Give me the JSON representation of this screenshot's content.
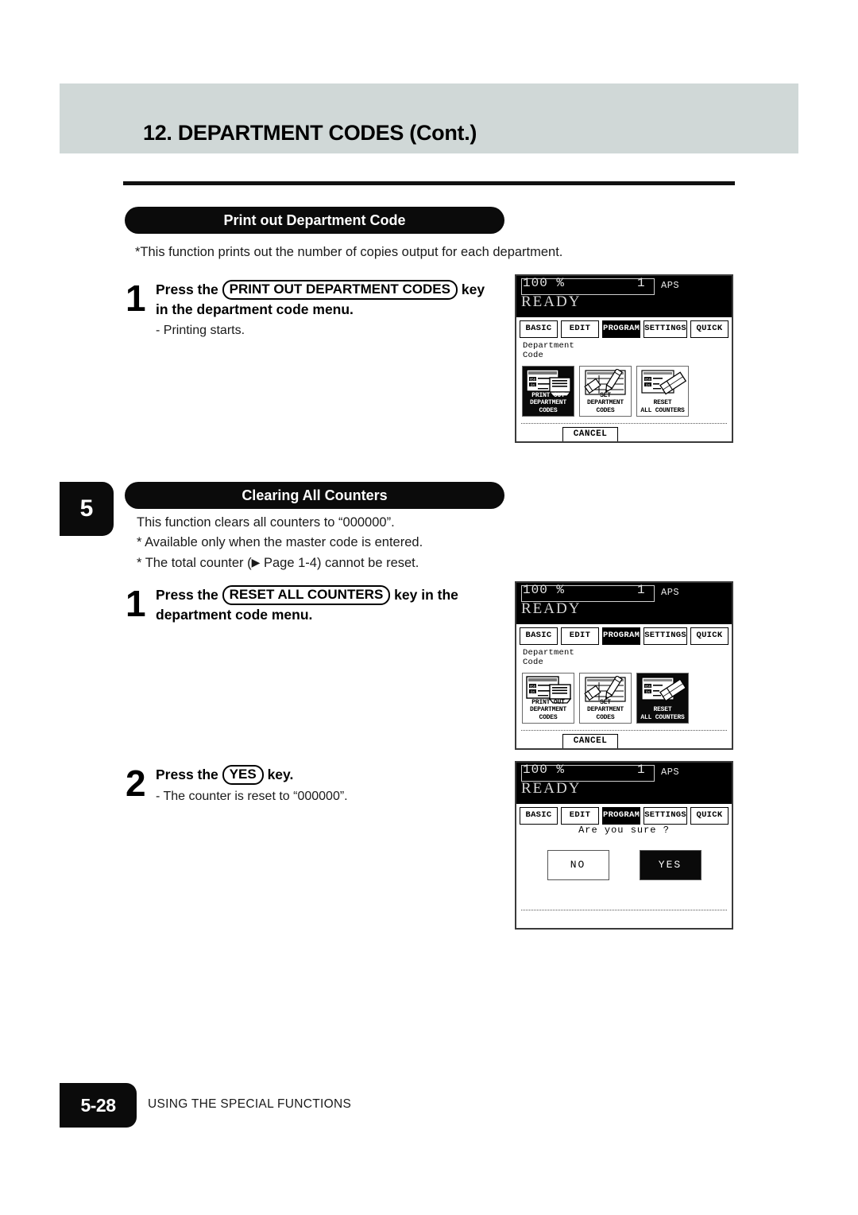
{
  "header": {
    "title": "12. DEPARTMENT CODES (Cont.)"
  },
  "sections": {
    "print_out": {
      "heading": "Print out Department Code",
      "note": "*This function prints out the number of copies output for each department.",
      "step1": {
        "number": "1",
        "line1_before": "Press the",
        "keycap": "PRINT OUT DEPARTMENT CODES",
        "line1_after": "key",
        "line2": "in the department code menu.",
        "sub": "-  Printing starts."
      }
    },
    "clearing": {
      "chapter_number": "5",
      "heading": "Clearing All Counters",
      "note1": "This function clears all counters to “000000”.",
      "note2": "*  Available only when the master code is entered.",
      "note3_pre": "*  The total counter (",
      "note3_arrow": "▶",
      "note3_post": " Page 1-4) cannot be reset.",
      "step1": {
        "number": "1",
        "line1_before": "Press the",
        "keycap": "RESET ALL COUNTERS",
        "line1_after": "key in the",
        "line2": "department code menu."
      },
      "step2": {
        "number": "2",
        "line1_before": "Press the",
        "keycap": "YES",
        "line1_after": "key.",
        "sub": "-  The counter is reset to “000000”."
      }
    }
  },
  "lcd_common": {
    "ratio": "100  %",
    "copies": "1",
    "paper_mode": "APS",
    "status": "READY",
    "tabs": [
      {
        "label": "BASIC",
        "selected": false
      },
      {
        "label": "EDIT",
        "selected": false
      },
      {
        "label": "PROGRAM",
        "selected": true
      },
      {
        "label": "SETTINGS",
        "selected": false
      },
      {
        "label": "QUICK",
        "selected": false
      }
    ],
    "menu_label": "Department\nCode",
    "cancel_label": "CANCEL",
    "icons": [
      {
        "caption_line1": "PRINT OUT",
        "caption_line2": "DEPARTMENT CODES"
      },
      {
        "caption_line1": "SET",
        "caption_line2": "DEPARTMENT CODES"
      },
      {
        "caption_line1": "RESET",
        "caption_line2": "ALL COUNTERS"
      }
    ]
  },
  "lcd_panels": {
    "panel1": {
      "selected_icon_index": 0
    },
    "panel2": {
      "selected_icon_index": 2
    },
    "panel3": {
      "message": "Are you sure ?",
      "no_label": "NO",
      "yes_label": "YES",
      "selected_button": "YES"
    }
  },
  "footer": {
    "page_number": "5-28",
    "section_name": "USING THE SPECIAL FUNCTIONS"
  },
  "colors": {
    "header_band": "#d0d8d7",
    "ink": "#0b0b0b",
    "paper": "#ffffff"
  }
}
